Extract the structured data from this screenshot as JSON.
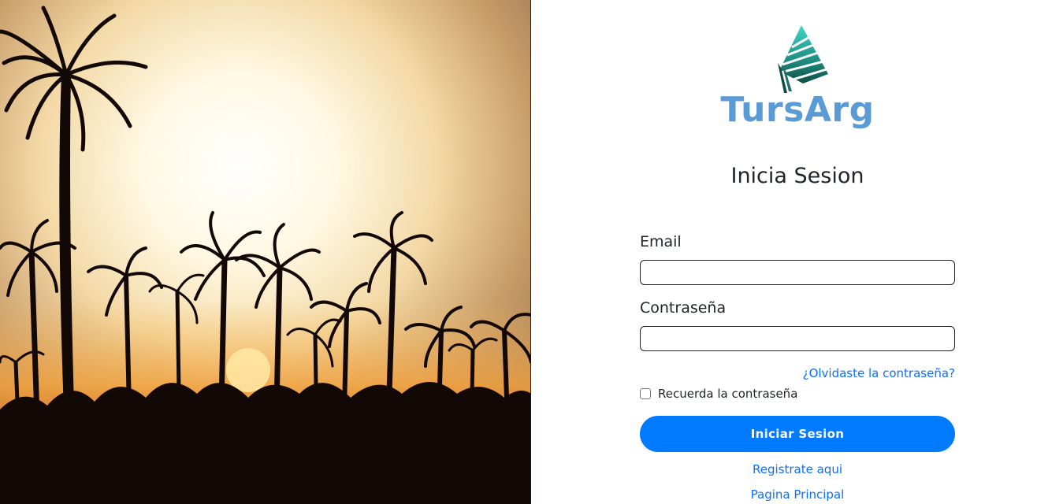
{
  "brand": {
    "name": "TursArg",
    "color": "#5b9bd5",
    "logo_colors": [
      "#3fd6c8",
      "#1e8f80",
      "#0f4d44"
    ]
  },
  "photo": {
    "icon": "palm-sunset-photo"
  },
  "login": {
    "heading": "Inicia Sesion",
    "email_label": "Email",
    "email_value": "",
    "password_label": "Contraseña",
    "password_value": "",
    "forgot_link": "¿Olvidaste la contraseña?",
    "remember_label": "Recuerda la contraseña",
    "remember_checked": false,
    "submit_label": "Iniciar Sesion",
    "register_link": "Registrate aqui",
    "home_link": "Pagina Principal"
  },
  "colors": {
    "primary": "#007bff",
    "link": "#0d6efd",
    "text": "#212529"
  }
}
